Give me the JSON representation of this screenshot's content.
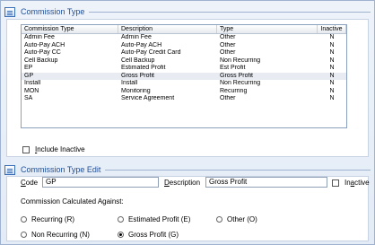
{
  "section1": {
    "title": "Commission Type",
    "columns": [
      "Commission Type",
      "Description",
      "Type",
      "Inactive"
    ],
    "rows": [
      [
        "Admin Fee",
        "Admin Fee",
        "Other",
        "N"
      ],
      [
        "Auto-Pay ACH",
        "Auto-Pay ACH",
        "Other",
        "N"
      ],
      [
        "Auto-Pay CC",
        "Auto-Pay Credit Card",
        "Other",
        "N"
      ],
      [
        "Cell Backup",
        "Cell Backup",
        "Non Recurring",
        "N"
      ],
      [
        "EP",
        "Estimated Profit",
        "Est Profit",
        "N"
      ],
      [
        "GP",
        "Gross Profit",
        "Gross Profit",
        "N"
      ],
      [
        "Install",
        "Install",
        "Non Recurring",
        "N"
      ],
      [
        "MON",
        "Monitoring",
        "Recurring",
        "N"
      ],
      [
        "SA",
        "Service Agreement",
        "Other",
        "N"
      ]
    ],
    "selected_row": 5,
    "include_inactive_label_prefix": "I",
    "include_inactive_label_rest": "nclude Inactive"
  },
  "section2": {
    "title": "Commission Type Edit",
    "code_label_prefix": "C",
    "code_label_rest": "ode",
    "code_value": "GP",
    "desc_label_prefix": "D",
    "desc_label_rest": "escription",
    "desc_value": "Gross Profit",
    "inactive_label_prefix": "In",
    "inactive_label_u": "a",
    "inactive_label_rest": "ctive",
    "calc_label": "Commission Calculated Against:",
    "radios": [
      {
        "label": "Recurring (R)",
        "checked": false
      },
      {
        "label": "Estimated Profit (E)",
        "checked": false
      },
      {
        "label": "Other (O)",
        "checked": false
      },
      {
        "label": "Non Recurring (N)",
        "checked": false
      },
      {
        "label": "Gross Profit (G)",
        "checked": true
      }
    ]
  }
}
